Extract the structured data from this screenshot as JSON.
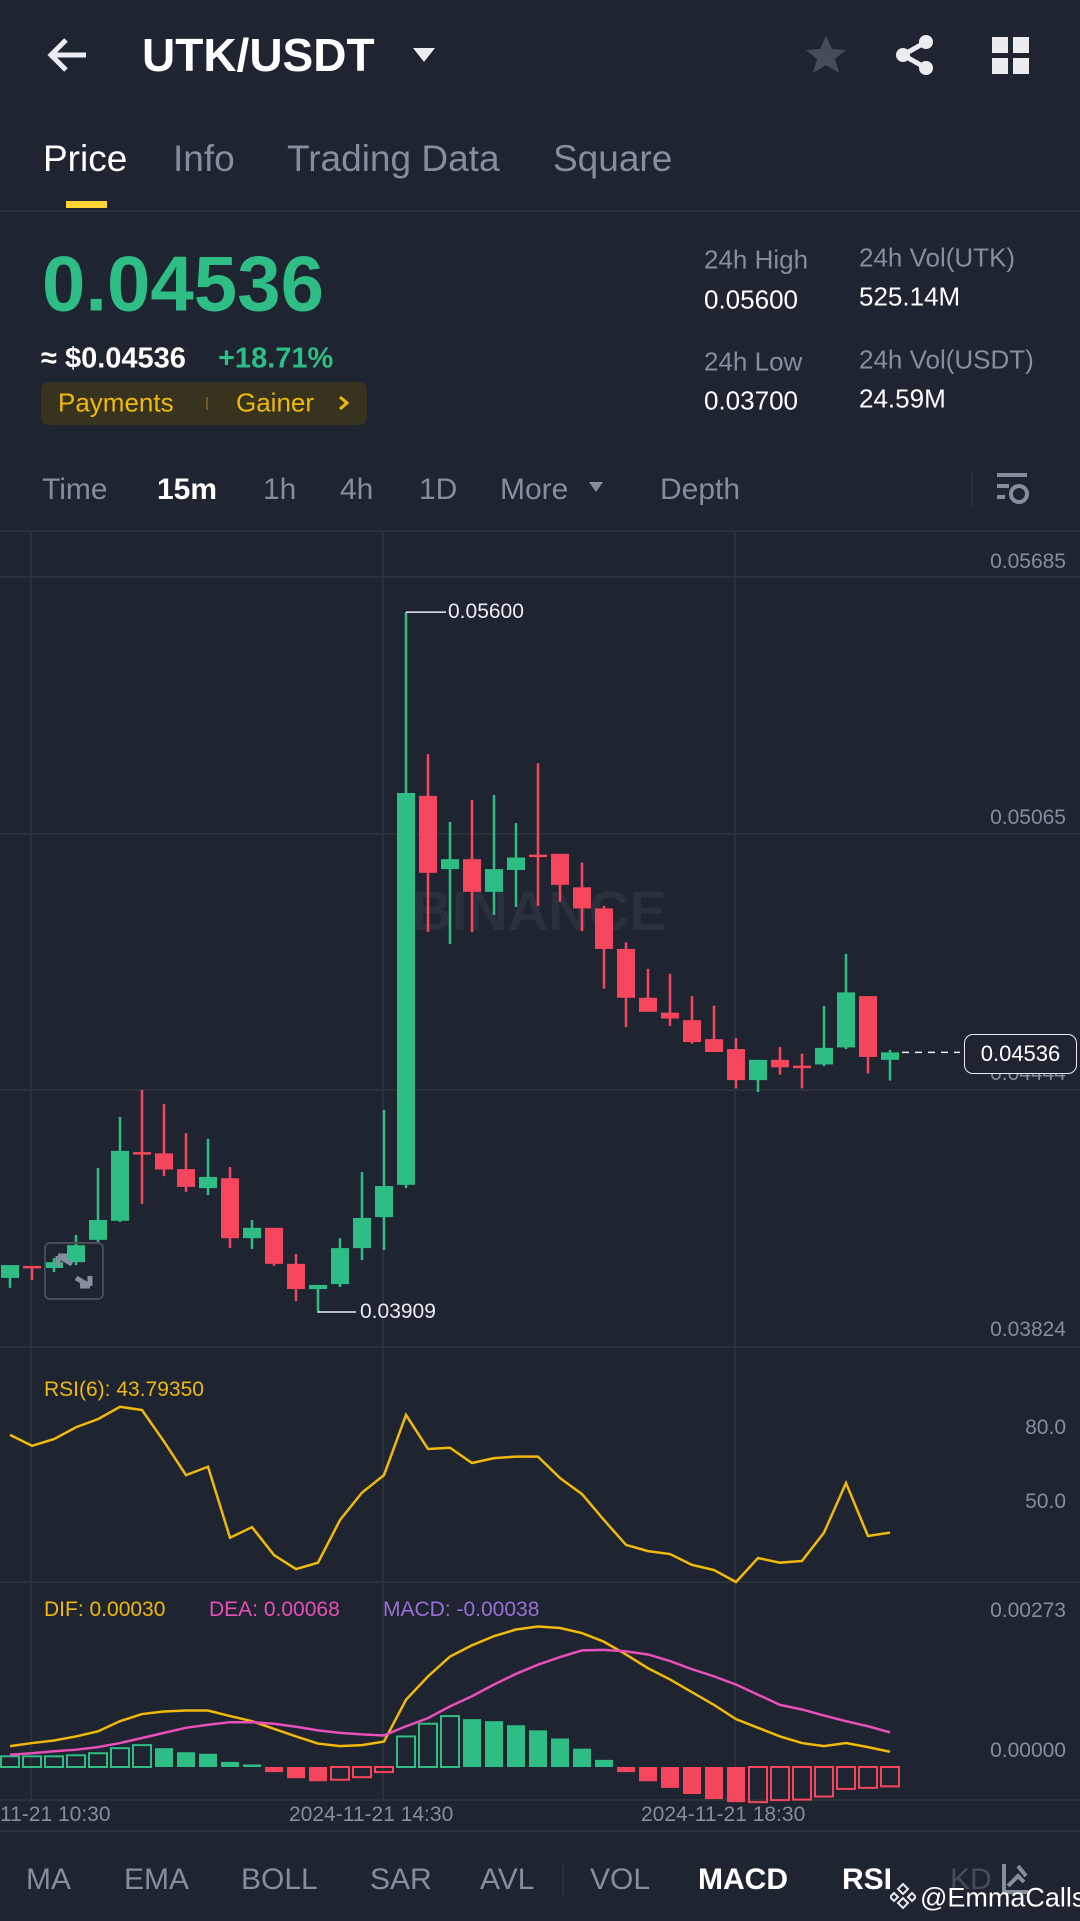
{
  "header": {
    "pair": "UTK/USDT"
  },
  "tabs": [
    "Price",
    "Info",
    "Trading Data",
    "Square"
  ],
  "ticker": {
    "price": "0.04536",
    "approx": "≈ $0.04536",
    "change": "+18.71%",
    "tags": [
      "Payments",
      "Gainer"
    ],
    "stats": {
      "high_label": "24h High",
      "high": "0.05600",
      "low_label": "24h Low",
      "low": "0.03700",
      "vol_utk_label": "24h Vol(UTK)",
      "vol_utk": "525.14M",
      "vol_usdt_label": "24h Vol(USDT)",
      "vol_usdt": "24.59M"
    }
  },
  "intervals": [
    "Time",
    "15m",
    "1h",
    "4h",
    "1D",
    "More",
    "Depth"
  ],
  "indicators": [
    "MA",
    "EMA",
    "BOLL",
    "SAR",
    "AVL",
    "VOL",
    "MACD",
    "RSI",
    "KD"
  ],
  "watermark": {
    "user": "@EmmaCalls",
    "chart": "BINANCE"
  },
  "colors": {
    "up": "#2ebd85",
    "down": "#f6465d",
    "accent": "#fcd535",
    "dif": "#f0b90b",
    "dea": "#e84fb8",
    "macd": "#9a6fd6",
    "rsi": "#f0b90b"
  },
  "chart_data": [
    {
      "type": "candlestick",
      "interval": "15m",
      "ylim": [
        0.03824,
        0.05685
      ],
      "price_axis_labels": [
        "0.05685",
        "0.05065",
        "0.04444",
        "0.03824"
      ],
      "x_labels": [
        "11-21 10:30",
        "2024-11-21 14:30",
        "2024-11-21 18:30"
      ],
      "high_marker": "0.05600",
      "low_marker": "0.03909",
      "current_price": "0.04536",
      "ohlc": [
        [
          0.03991,
          0.04022,
          0.03967,
          0.04022
        ],
        [
          0.0402,
          0.0402,
          0.03986,
          0.04015
        ],
        [
          0.04015,
          0.04039,
          0.04005,
          0.04029
        ],
        [
          0.04029,
          0.04095,
          0.04022,
          0.0407
        ],
        [
          0.04083,
          0.04257,
          0.04073,
          0.04131
        ],
        [
          0.04129,
          0.0438,
          0.04126,
          0.04298
        ],
        [
          0.04295,
          0.04445,
          0.0417,
          0.0429
        ],
        [
          0.04292,
          0.04411,
          0.04237,
          0.04253
        ],
        [
          0.04254,
          0.04341,
          0.04199,
          0.04211
        ],
        [
          0.04208,
          0.04327,
          0.04191,
          0.04235
        ],
        [
          0.04232,
          0.04259,
          0.04063,
          0.04087
        ],
        [
          0.04087,
          0.04131,
          0.04061,
          0.04112
        ],
        [
          0.04112,
          0.04112,
          0.0402,
          0.04025
        ],
        [
          0.04025,
          0.04049,
          0.03935,
          0.03964
        ],
        [
          0.03964,
          0.03974,
          0.03909,
          0.03974
        ],
        [
          0.03976,
          0.04087,
          0.03969,
          0.04063
        ],
        [
          0.04063,
          0.04247,
          0.04034,
          0.04136
        ],
        [
          0.04138,
          0.04397,
          0.04058,
          0.04213
        ],
        [
          0.04216,
          0.056,
          0.04208,
          0.05163
        ],
        [
          0.05156,
          0.05257,
          0.04827,
          0.0497
        ],
        [
          0.04979,
          0.05093,
          0.04798,
          0.05003
        ],
        [
          0.05003,
          0.05146,
          0.04827,
          0.04924
        ],
        [
          0.04924,
          0.05158,
          0.04868,
          0.04979
        ],
        [
          0.04977,
          0.0509,
          0.04887,
          0.05007
        ],
        [
          0.05014,
          0.05235,
          0.0489,
          0.05011
        ],
        [
          0.05016,
          0.05016,
          0.049,
          0.04941
        ],
        [
          0.04935,
          0.04995,
          0.04829,
          0.04884
        ],
        [
          0.04884,
          0.0489,
          0.0469,
          0.04786
        ],
        [
          0.04786,
          0.04802,
          0.04597,
          0.04668
        ],
        [
          0.04668,
          0.04738,
          0.04634,
          0.04634
        ],
        [
          0.04632,
          0.04726,
          0.046,
          0.04618
        ],
        [
          0.04614,
          0.04672,
          0.04557,
          0.04561
        ],
        [
          0.04568,
          0.04649,
          0.04537,
          0.04537
        ],
        [
          0.04544,
          0.04571,
          0.04449,
          0.04469
        ],
        [
          0.04469,
          0.04518,
          0.0444,
          0.04518
        ],
        [
          0.04518,
          0.04549,
          0.04482,
          0.045
        ],
        [
          0.04504,
          0.04533,
          0.04449,
          0.04501
        ],
        [
          0.04507,
          0.04648,
          0.04503,
          0.04547
        ],
        [
          0.04548,
          0.04774,
          0.04544,
          0.04681
        ],
        [
          0.04672,
          0.04672,
          0.04485,
          0.04525
        ],
        [
          0.04518,
          0.04542,
          0.04468,
          0.04536
        ]
      ]
    },
    {
      "type": "line",
      "title": "RSI(6): 43.79350",
      "axis_labels": [
        "80.0",
        "50.0"
      ],
      "values": [
        77.2,
        72.8,
        75.5,
        80.3,
        83.6,
        88.6,
        87.3,
        74.5,
        60.9,
        64.3,
        35.5,
        39.8,
        28.5,
        22.8,
        25.4,
        42.7,
        53.8,
        60.9,
        85.3,
        71.5,
        72.0,
        65.8,
        67.8,
        68.4,
        68.4,
        59.7,
        53.2,
        42.7,
        32.6,
        30.1,
        28.9,
        24.5,
        22.4,
        17.3,
        27.3,
        25.4,
        26.1,
        37.6,
        57.7,
        36.2,
        37.6
      ]
    },
    {
      "type": "macd",
      "dif_label": "DIF: 0.00030",
      "dea_label": "DEA: 0.00068",
      "macd_label": "MACD: -0.00038",
      "axis_labels": [
        "0.00273",
        "0.00000"
      ],
      "dif": [
        0.00041,
        0.00047,
        0.00052,
        0.0006,
        0.0007,
        0.0009,
        0.00104,
        0.00109,
        0.00111,
        0.00111,
        0.001,
        0.0009,
        0.00075,
        0.0006,
        0.00046,
        0.00041,
        0.00043,
        0.0005,
        0.00132,
        0.00178,
        0.00217,
        0.00239,
        0.00257,
        0.0027,
        0.00276,
        0.00273,
        0.00263,
        0.00246,
        0.00221,
        0.00194,
        0.00172,
        0.00147,
        0.00122,
        0.00094,
        0.00077,
        0.0006,
        0.00047,
        0.00041,
        0.00047,
        0.00039,
        0.0003
      ],
      "dea": [
        0.00024,
        0.00027,
        0.00031,
        0.00034,
        0.00039,
        0.00047,
        0.00057,
        0.00067,
        0.00077,
        0.00083,
        0.00088,
        0.00088,
        0.00085,
        0.00079,
        0.00072,
        0.00067,
        0.00064,
        0.00062,
        0.0008,
        0.00096,
        0.00119,
        0.00139,
        0.00162,
        0.00183,
        0.00201,
        0.00216,
        0.00229,
        0.0023,
        0.00227,
        0.00221,
        0.00208,
        0.00192,
        0.00178,
        0.00162,
        0.00142,
        0.00122,
        0.00113,
        0.00101,
        0.0009,
        0.0008,
        0.00068
      ],
      "hist": [
        0.00021,
        0.00021,
        0.00021,
        0.00023,
        0.00027,
        0.00037,
        0.00043,
        0.00037,
        0.00029,
        0.00026,
        0.0001,
        5e-05,
        -0.0001,
        -0.00022,
        -0.00028,
        -0.00025,
        -0.0002,
        -0.0001,
        0.0006,
        0.00085,
        0.001,
        0.00094,
        0.0009,
        0.00082,
        0.00072,
        0.00056,
        0.00036,
        0.00014,
        -0.0001,
        -0.00028,
        -0.00041,
        -0.00053,
        -0.00063,
        -0.00069,
        -0.00069,
        -0.00065,
        -0.00064,
        -0.00058,
        -0.00043,
        -0.00041,
        -0.00038
      ]
    }
  ]
}
